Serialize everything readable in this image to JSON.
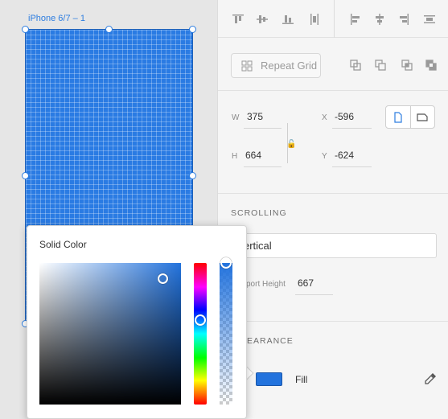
{
  "canvas": {
    "artboard_label": "iPhone 6/7 – 1"
  },
  "toolbar": {
    "icons": [
      "align-top-icon",
      "align-middle-icon",
      "align-bottom-icon",
      "distribute-vertical-icon",
      "align-left-icon",
      "align-center-icon",
      "align-right-icon",
      "distribute-horizontal-icon"
    ]
  },
  "repeat_grid": {
    "label": "Repeat Grid"
  },
  "transform": {
    "w_label": "W",
    "w_value": "375",
    "h_label": "H",
    "h_value": "664",
    "x_label": "X",
    "x_value": "-596",
    "y_label": "Y",
    "y_value": "-624"
  },
  "scrolling": {
    "title": "SCROLLING",
    "mode": "ertical",
    "viewport_label": "port Height",
    "viewport_value": "667"
  },
  "appearance": {
    "title": "EARANCE",
    "fill_label": "Fill",
    "fill_color": "#2373dd"
  },
  "color_picker": {
    "title": "Solid Color",
    "hue_color": "#2373dd"
  }
}
